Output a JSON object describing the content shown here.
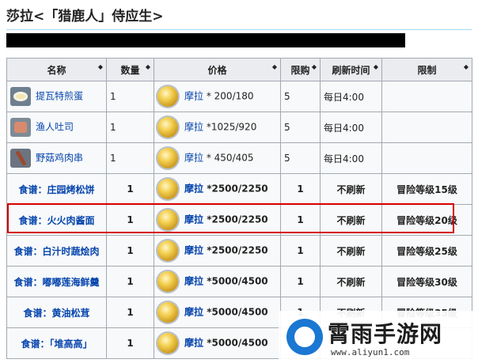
{
  "page": {
    "title": "莎拉<「猎鹿人」侍应生>"
  },
  "table": {
    "headers": [
      "名称",
      "数量",
      "价格",
      "限购",
      "刷新时间",
      "限制"
    ],
    "sort_glyph": "◆",
    "rows": [
      {
        "icon": "omelette-icon",
        "name": "提瓦特煎蛋",
        "qty": "1",
        "currency": "摩拉",
        "price": "* 200/180",
        "limit": "5",
        "refresh": "每日4:00",
        "restriction": ""
      },
      {
        "icon": "toast-icon",
        "name": "渔人吐司",
        "qty": "1",
        "currency": "摩拉",
        "price": "*1025/920",
        "limit": "5",
        "refresh": "每日4:00",
        "restriction": ""
      },
      {
        "icon": "skewer-icon",
        "name": "野菇鸡肉串",
        "qty": "1",
        "currency": "摩拉",
        "price": "* 450/405",
        "limit": "5",
        "refresh": "每日4:00",
        "restriction": ""
      },
      {
        "icon": "",
        "name": "食谱：庄园烤松饼",
        "qty": "1",
        "currency": "摩拉",
        "price": "*2500/2250",
        "limit": "1",
        "refresh": "不刷新",
        "restriction": "冒险等级15级"
      },
      {
        "icon": "",
        "name": "食谱：火火肉酱面",
        "qty": "1",
        "currency": "摩拉",
        "price": "*2500/2250",
        "limit": "1",
        "refresh": "不刷新",
        "restriction": "冒险等级20级"
      },
      {
        "icon": "",
        "name": "食谱：白汁时蔬烩肉",
        "qty": "1",
        "currency": "摩拉",
        "price": "*2500/2250",
        "limit": "1",
        "refresh": "不刷新",
        "restriction": "冒险等级25级"
      },
      {
        "icon": "",
        "name": "食谱：嘟嘟莲海鲜羹",
        "qty": "1",
        "currency": "摩拉",
        "price": "*5000/4500",
        "limit": "1",
        "refresh": "不刷新",
        "restriction": "冒险等级30级"
      },
      {
        "icon": "",
        "name": "食谱：黄油松茸",
        "qty": "1",
        "currency": "摩拉",
        "price": "*5000/4500",
        "limit": "1",
        "refresh": "不刷新",
        "restriction": "冒险等级35级"
      },
      {
        "icon": "",
        "name": "食谱：「堆高高」",
        "qty": "1",
        "currency": "摩拉",
        "price": "*5000/4500",
        "limit": "1",
        "refresh": "",
        "restriction": ""
      }
    ]
  },
  "watermark": {
    "text": "霄雨手游网",
    "url": "www.aliyun1.com"
  }
}
